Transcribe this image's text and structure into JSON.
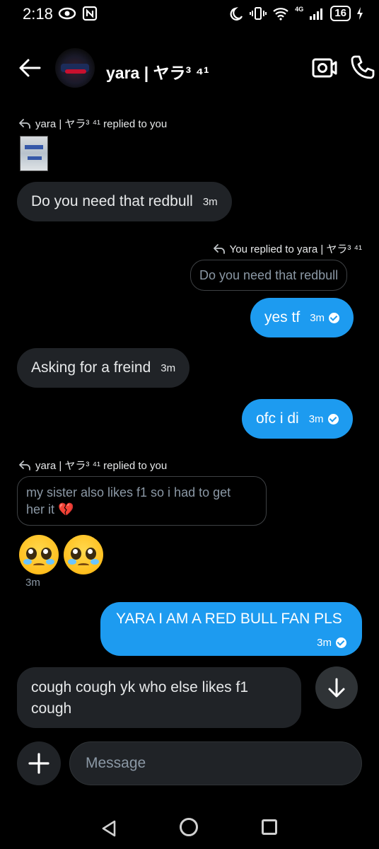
{
  "status_bar": {
    "time": "2:18",
    "network": "4G",
    "battery": "16"
  },
  "header": {
    "name": "yara | ヤラ³ ⁴¹",
    "icons": [
      "back-arrow-icon",
      "video-call-icon",
      "phone-icon"
    ]
  },
  "messages": {
    "reply1_label": "yara | ヤラ³ ⁴¹ replied to you",
    "m1_text": "Do you need that redbull",
    "m1_time": "3m",
    "reply2_label": "You replied to yara | ヤラ³ ⁴¹",
    "quote2_text": "Do you need that redbull",
    "m2_text": "yes tf",
    "m2_time": "3m",
    "m3_text": "Asking for a freind",
    "m3_time": "3m",
    "m4_text": "ofc i di",
    "m4_time": "3m",
    "reply3_label": "yara | ヤラ³ ⁴¹ replied to you",
    "quote3_line1": "my sister also likes f1 so i had to get",
    "quote3_line2": "her it 💔",
    "m5_emoji": "🥹🥹",
    "m5_time": "3m",
    "m6_text": "YARA I AM A RED BULL FAN PLS",
    "m6_time": "3m",
    "m7_line1": "cough cough yk who else likes f1",
    "m7_line2": "cough"
  },
  "composer": {
    "placeholder": "Message"
  },
  "colors": {
    "background": "#000000",
    "incoming_bubble": "#202327",
    "outgoing_bubble": "#1d9bf0",
    "text": "#e7e9ea",
    "muted": "#8b98a5"
  }
}
